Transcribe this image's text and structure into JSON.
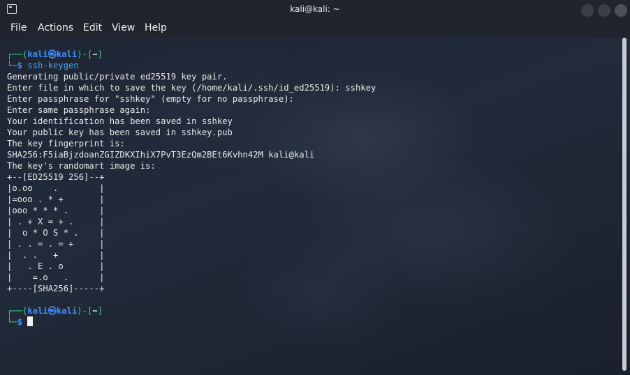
{
  "window": {
    "title": "kali@kali: ~"
  },
  "menu": {
    "items": [
      "File",
      "Actions",
      "Edit",
      "View",
      "Help"
    ]
  },
  "terminal": {
    "prompt": {
      "user": "kali",
      "at_symbol": "㉿",
      "host": "kali",
      "dir": "~",
      "symbol": "$"
    },
    "command": "ssh-keygen",
    "output": [
      "Generating public/private ed25519 key pair.",
      "Enter file in which to save the key (/home/kali/.ssh/id_ed25519): sshkey",
      "Enter passphrase for \"sshkey\" (empty for no passphrase):",
      "Enter same passphrase again:",
      "Your identification has been saved in sshkey",
      "Your public key has been saved in sshkey.pub",
      "The key fingerprint is:",
      "SHA256:F5iaBjzdoanZGIZDKXIhiX7PvT3EzQm2BEt6Kvhn42M kali@kali",
      "The key's randomart image is:",
      "+--[ED25519 256]--+",
      "|o.oo    .        |",
      "|=ooo . * +       |",
      "|ooo * * * .      |",
      "| . + X = + .     |",
      "|  o * O S * .    |",
      "| . . = . = +     |",
      "|  . .   +        |",
      "|   . E . o       |",
      "|    =.o   .      |",
      "+----[SHA256]-----+"
    ]
  }
}
